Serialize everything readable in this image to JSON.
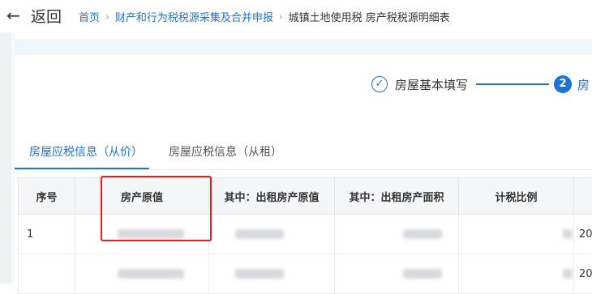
{
  "header": {
    "back_label": "返回",
    "breadcrumb": {
      "home": "首页",
      "section": "财产和行为税税源采集及合并申报",
      "current": "城镇土地使用税 房产税税源明细表"
    }
  },
  "steps": {
    "step1_label": "房屋基本填写",
    "step1_icon": "check-circle-icon",
    "step2_number": "2",
    "step2_label": "房"
  },
  "tabs": [
    {
      "label": "房屋应税信息（从价）",
      "active": true
    },
    {
      "label": "房屋应税信息（从租）",
      "active": false
    }
  ],
  "table": {
    "headers": [
      "序号",
      "房产原值",
      "其中：出租房产原值",
      "其中：出租房产面积",
      "计税比例",
      ""
    ],
    "rows": [
      {
        "index": "1",
        "last": "20"
      },
      {
        "index": "",
        "last": "20"
      }
    ]
  },
  "colors": {
    "accent": "#1f72d6",
    "highlight": "#e0201f"
  }
}
